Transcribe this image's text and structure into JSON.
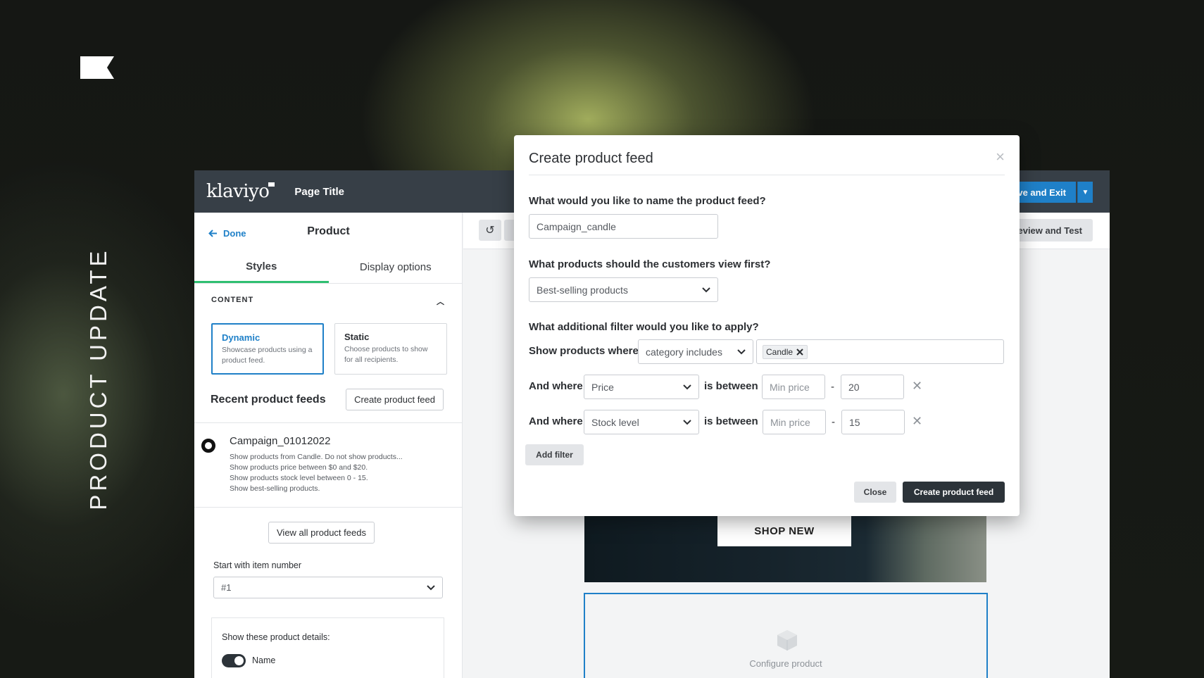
{
  "promo": {
    "vertical_title": "PRODUCT UPDATE"
  },
  "app": {
    "logo_text": "klaviyo",
    "page_title": "Page Title",
    "save_exit_label": "ve and Exit",
    "preview_label": "eview and Test"
  },
  "left_panel": {
    "done_label": "Done",
    "title": "Product",
    "tabs": [
      {
        "label": "Styles",
        "active": true
      },
      {
        "label": "Display options",
        "active": false
      }
    ],
    "section_label": "CONTENT",
    "modes": [
      {
        "title": "Dynamic",
        "desc": "Showcase products using a product feed.",
        "selected": true
      },
      {
        "title": "Static",
        "desc": "Choose products to show for all recipients.",
        "selected": false
      }
    ],
    "recent_title": "Recent product feeds",
    "create_feed_label": "Create product feed",
    "feed": {
      "name": "Campaign_01012022",
      "lines": [
        "Show products from Candle. Do not show products...",
        "Show products price between $0 and $20.",
        "Show products stock level between 0 - 15.",
        "Show best-selling products."
      ]
    },
    "view_all_label": "View all product feeds",
    "start_label": "Start with item number",
    "start_value": "#1",
    "details_label": "Show these product details:",
    "toggle_label": "Name"
  },
  "canvas": {
    "shop_label": "SHOP NEW",
    "configure_label": "Configure product"
  },
  "modal": {
    "title": "Create product feed",
    "q_name": "What would you like to name the product feed?",
    "name_value": "Campaign_candle",
    "q_view": "What products should the customers view first?",
    "view_value": "Best-selling products",
    "q_filter": "What additional filter would you like to apply?",
    "show_where": "Show products where",
    "condition_value": "category includes",
    "chip_label": "Candle",
    "filters": [
      {
        "and_where": "And where",
        "field": "Price",
        "between": "is between",
        "min_placeholder": "Min price",
        "max_value": "20"
      },
      {
        "and_where": "And where",
        "field": "Stock level",
        "between": "is between",
        "min_placeholder": "Min price",
        "max_value": "15"
      }
    ],
    "dash": "-",
    "add_filter_label": "Add filter",
    "close_label": "Close",
    "create_label": "Create product feed"
  },
  "colors": {
    "accent": "#1f80c8",
    "tab_active": "#2fbf71",
    "header": "#373f47",
    "primary_button": "#2c3339"
  }
}
